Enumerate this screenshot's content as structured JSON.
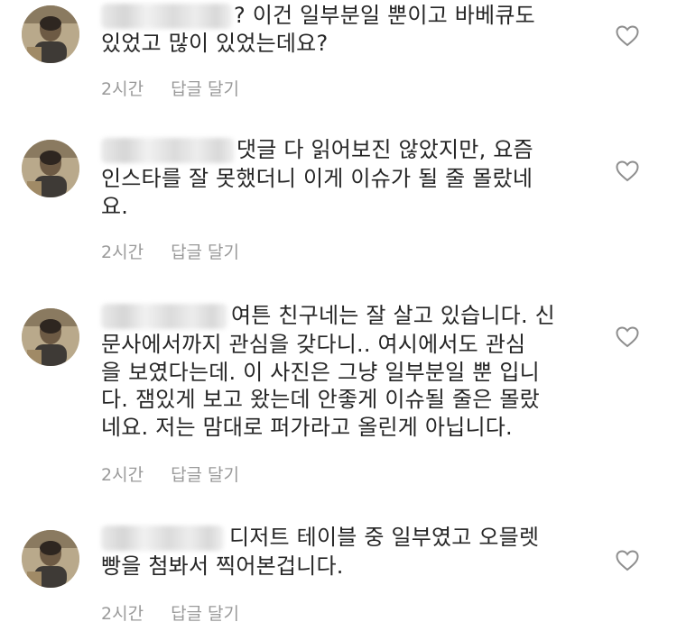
{
  "comments": [
    {
      "lines": [
        "? 이건 일부분일 뿐이고 바베큐도",
        "있었고 많이 있었는데요?"
      ],
      "time": "2시간",
      "reply_label": "답글 달기"
    },
    {
      "lines": [
        "댓글 다 읽어보진 않았지만,  요즘",
        "인스타를 잘 못했더니 이게 이슈가 될 줄 몰랐네",
        "요."
      ],
      "time": "2시간",
      "reply_label": "답글 달기"
    },
    {
      "lines": [
        "여튼 친구네는 잘 살고 있습니다. 신",
        "문사에서까지 관심을 갖다니.. 여시에서도 관심",
        "을 보였다는데. 이 사진은 그냥 일부분일 뿐 입니",
        "다.  잼있게 보고 왔는데 안좋게 이슈될 줄은 몰랐",
        "네요.  저는 맘대로 퍼가라고 올린게 아닙니다."
      ],
      "time": "2시간",
      "reply_label": "답글 달기"
    },
    {
      "lines": [
        "디저트 테이블 중 일부였고 오믈렛",
        "빵을 첨봐서 찍어본겁니다."
      ],
      "time": "2시간",
      "reply_label": "답글 달기"
    }
  ]
}
